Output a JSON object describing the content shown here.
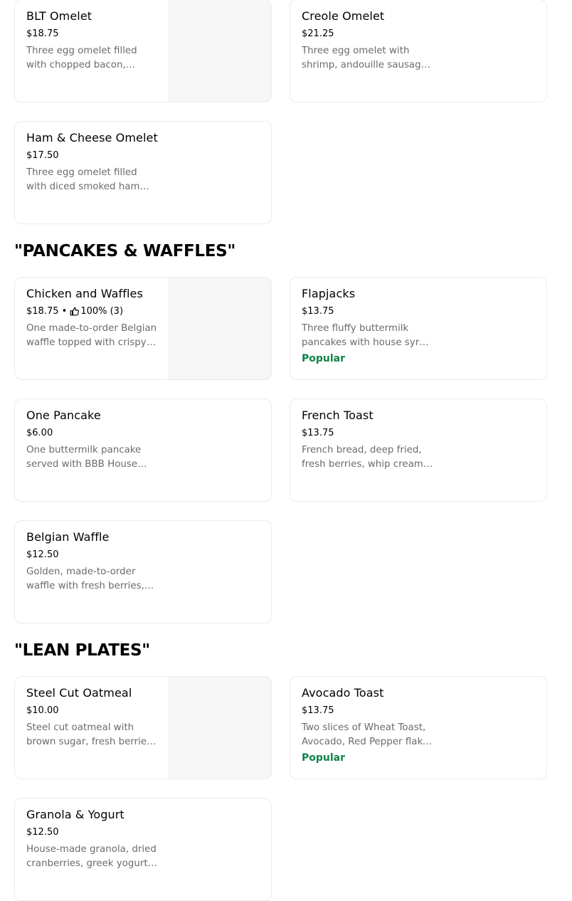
{
  "sections": [
    {
      "title": null,
      "items": [
        {
          "name": "BLT Omelet",
          "price": "$18.75",
          "description": "Three egg omelet filled with chopped bacon, tomatoes, and cheddar cheese",
          "has_image": true
        },
        {
          "name": "Creole Omelet",
          "price": "$21.25",
          "description": "Three egg omelet with shrimp, andouille sausage, and creole sauce",
          "has_image": false
        },
        {
          "name": "Ham & Cheese Omelet",
          "price": "$17.50",
          "description": "Three egg omelet filled with diced smoked ham and cheddar cheese",
          "has_image": false
        }
      ]
    },
    {
      "title": "\"PANCAKES & WAFFLES\"",
      "items": [
        {
          "name": "Chicken and Waffles",
          "price": "$18.75",
          "rating_text": "100% (3)",
          "description": "One made-to-order Belgian waffle topped with crispy fried chicken",
          "has_image": true
        },
        {
          "name": "Flapjacks",
          "price": "$13.75",
          "description": "Three fluffy buttermilk pancakes with house syrup and butter",
          "badge": "Popular",
          "has_image": false
        },
        {
          "name": "One Pancake",
          "price": "$6.00",
          "description": "One buttermilk pancake served with BBB House syrup",
          "has_image": false
        },
        {
          "name": "French Toast",
          "price": "$13.75",
          "description": "French bread, deep fried, fresh berries, whip cream, and syrup",
          "has_image": false
        },
        {
          "name": "Belgian Waffle",
          "price": "$12.50",
          "description": "Golden, made-to-order waffle with fresh berries, whip cream",
          "has_image": false
        }
      ]
    },
    {
      "title": "\"LEAN PLATES\"",
      "items": [
        {
          "name": "Steel Cut Oatmeal",
          "price": "$10.00",
          "description": "Steel cut oatmeal with brown sugar, fresh berries and milk",
          "has_image": true
        },
        {
          "name": "Avocado Toast",
          "price": "$13.75",
          "description": "Two slices of Wheat Toast, Avocado, Red Pepper flake, and lemon",
          "badge": "Popular",
          "has_image": false
        },
        {
          "name": "Granola & Yogurt",
          "price": "$12.50",
          "description": "House-made granola, dried cranberries, greek yogurt, and honey",
          "has_image": false
        }
      ]
    }
  ],
  "colors": {
    "popular": "#0e8345",
    "description": "#6b6b6b",
    "border": "#ebebeb",
    "image_placeholder": "#f6f6f6"
  },
  "icons": {
    "rating": "thumbs-up-icon"
  }
}
